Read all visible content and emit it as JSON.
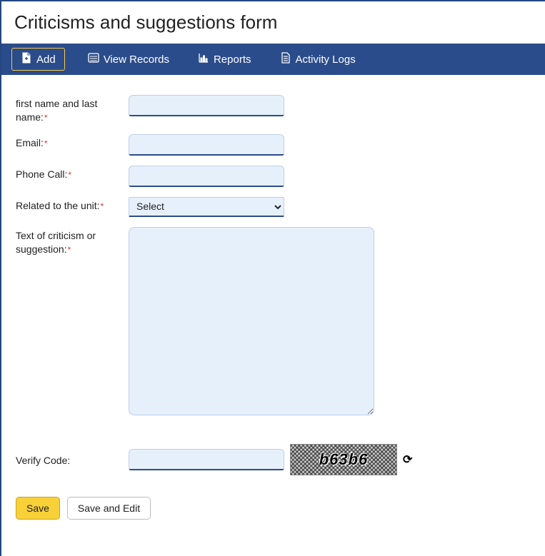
{
  "page": {
    "title": "Criticisms and suggestions form"
  },
  "toolbar": {
    "add": "Add",
    "view_records": "View Records",
    "reports": "Reports",
    "activity_logs": "Activity Logs"
  },
  "form": {
    "name": {
      "label": "first name and last name:",
      "value": ""
    },
    "email": {
      "label": "Email:",
      "value": ""
    },
    "phone": {
      "label": "Phone Call:",
      "value": ""
    },
    "unit": {
      "label": "Related to the unit:",
      "selected": "Select"
    },
    "text": {
      "label": "Text of criticism or suggestion:",
      "value": ""
    },
    "verify": {
      "label": "Verify Code:",
      "value": "",
      "captcha_text": "b63b6"
    }
  },
  "buttons": {
    "save": "Save",
    "save_edit": "Save and Edit"
  }
}
